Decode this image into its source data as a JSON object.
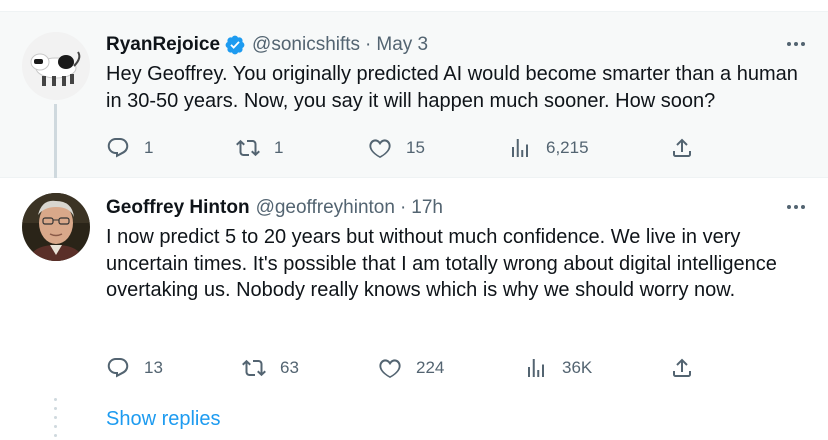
{
  "tweets": [
    {
      "display_name": "RyanRejoice",
      "handle": "@sonicshifts",
      "separator": "·",
      "time": "May 3",
      "verified": true,
      "text": "Hey Geoffrey. You originally predicted AI would become smarter than a human in 30-50 years. Now, you say it will happen much sooner. How soon?",
      "replies": "1",
      "retweets": "1",
      "likes": "15",
      "views": "6,215"
    },
    {
      "display_name": "Geoffrey Hinton",
      "handle": "@geoffreyhinton",
      "separator": "·",
      "time": "17h",
      "verified": false,
      "text": "I now predict 5 to 20 years but without much confidence. We live in very uncertain times. It's possible that I am totally wrong about digital intelligence overtaking us. Nobody really knows which is why we should worry now.",
      "replies": "13",
      "retweets": "63",
      "likes": "224",
      "views": "36K"
    }
  ],
  "show_replies_label": "Show replies",
  "colors": {
    "accent": "#1d9bf0",
    "secondary_text": "#536471",
    "primary_text": "#0f1419",
    "highlight_bg": "#f7f9f9"
  }
}
